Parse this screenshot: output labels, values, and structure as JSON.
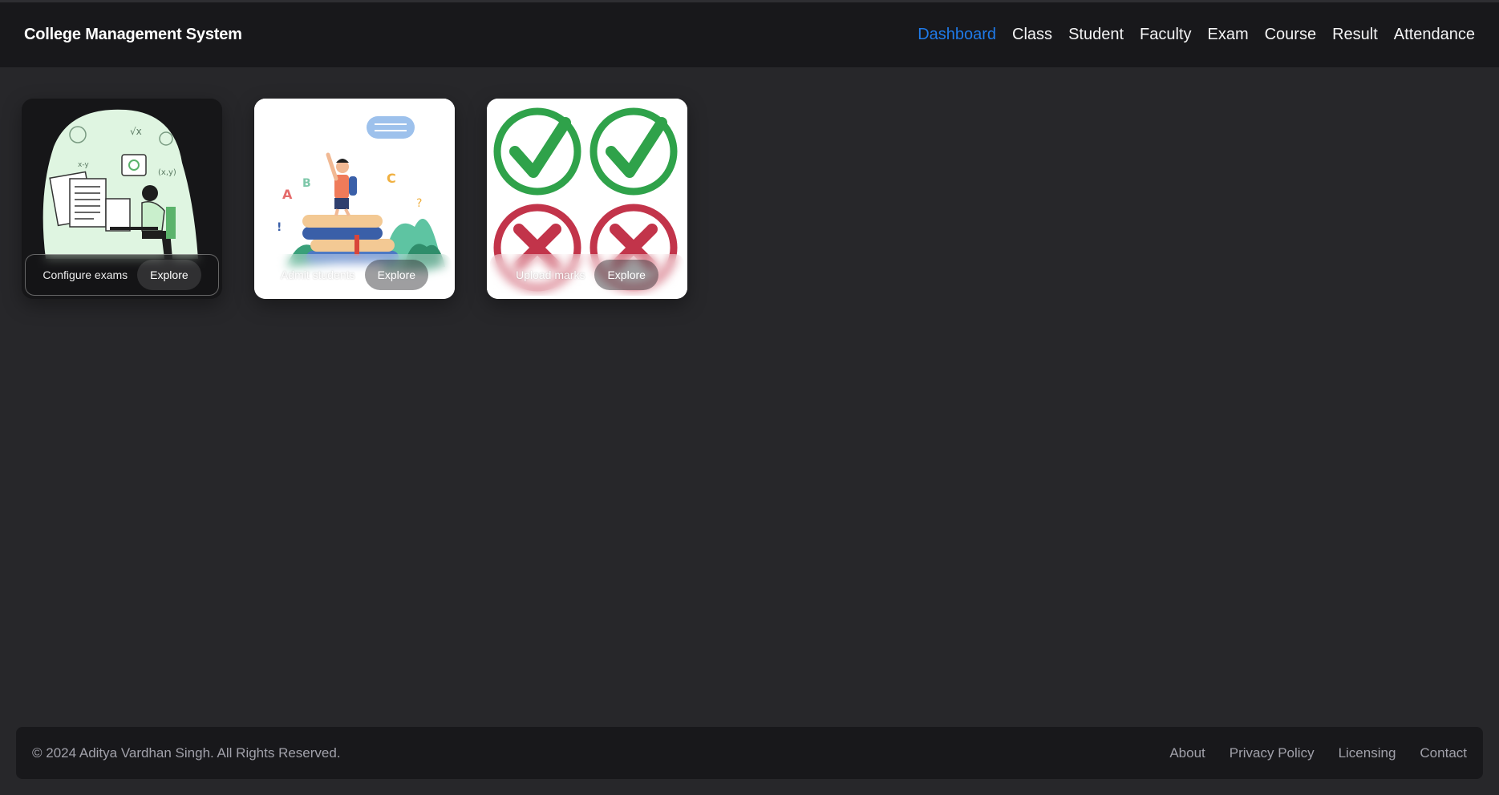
{
  "header": {
    "brand": "College Management System",
    "nav": [
      {
        "label": "Dashboard",
        "active": true
      },
      {
        "label": "Class"
      },
      {
        "label": "Student"
      },
      {
        "label": "Faculty"
      },
      {
        "label": "Exam"
      },
      {
        "label": "Course"
      },
      {
        "label": "Result"
      },
      {
        "label": "Attendance"
      }
    ],
    "active_color": "#1f7ae8"
  },
  "cards": [
    {
      "label": "Configure exams",
      "button": "Explore",
      "illustration": "student-writing-exam-illustration"
    },
    {
      "label": "Admit students",
      "button": "Explore",
      "illustration": "student-on-books-illustration"
    },
    {
      "label": "Upload marks",
      "button": "Explore",
      "illustration": "check-and-cross-marks-illustration"
    }
  ],
  "footer": {
    "copyright": "© 2024 Aditya Vardhan Singh. All Rights Reserved.",
    "links": [
      "About",
      "Privacy Policy",
      "Licensing",
      "Contact"
    ]
  }
}
